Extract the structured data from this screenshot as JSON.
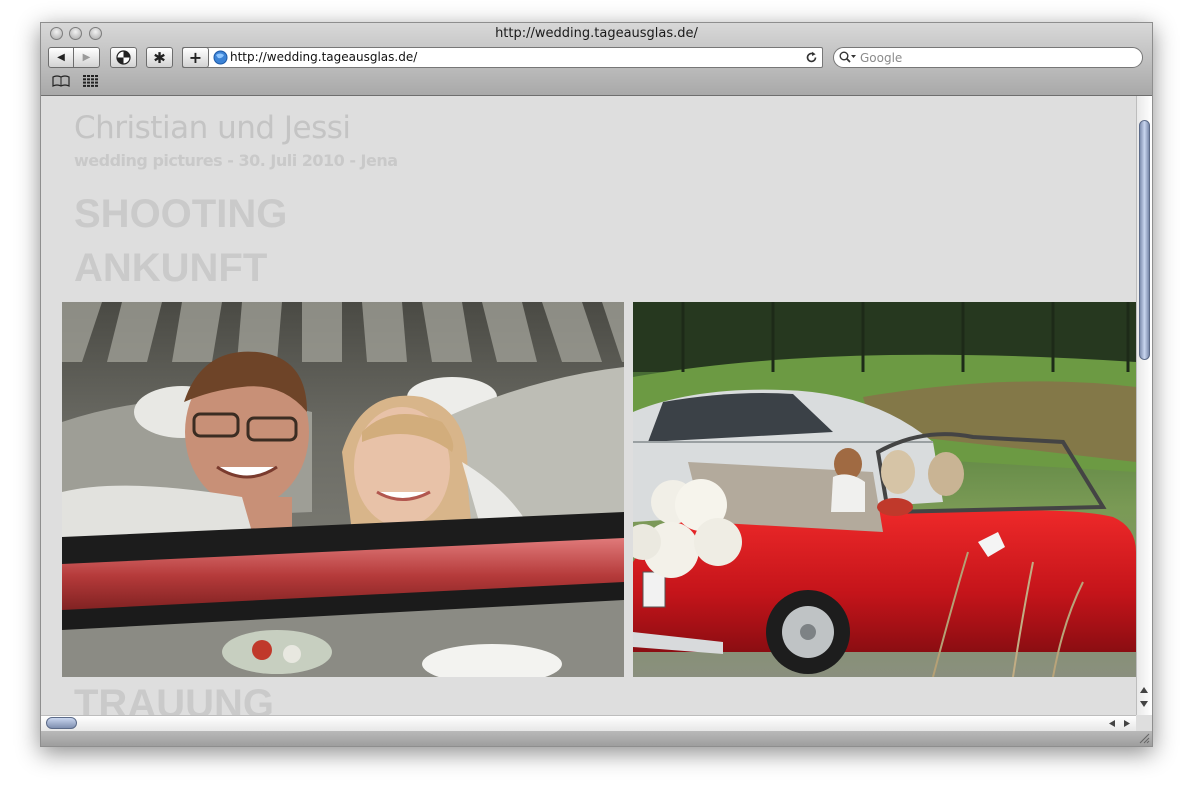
{
  "window": {
    "title": "http://wedding.tageausglas.de/"
  },
  "toolbar": {
    "back_icon": "◀",
    "forward_icon": "▶",
    "new_tab_icon": "+",
    "stop_icon": "✱"
  },
  "address_bar": {
    "url": "http://wedding.tageausglas.de/"
  },
  "search": {
    "placeholder": "Google"
  },
  "page": {
    "title": "Christian und Jessi",
    "subtitle": "wedding pictures - 30. Juli 2010 - Jena",
    "sections": [
      "SHOOTING",
      "ANKUNFT",
      "TRAUUNG"
    ]
  },
  "colors": {
    "page_background": "#dedede",
    "heading_text": "#c4c4c4",
    "car_red": "#d4141c"
  }
}
